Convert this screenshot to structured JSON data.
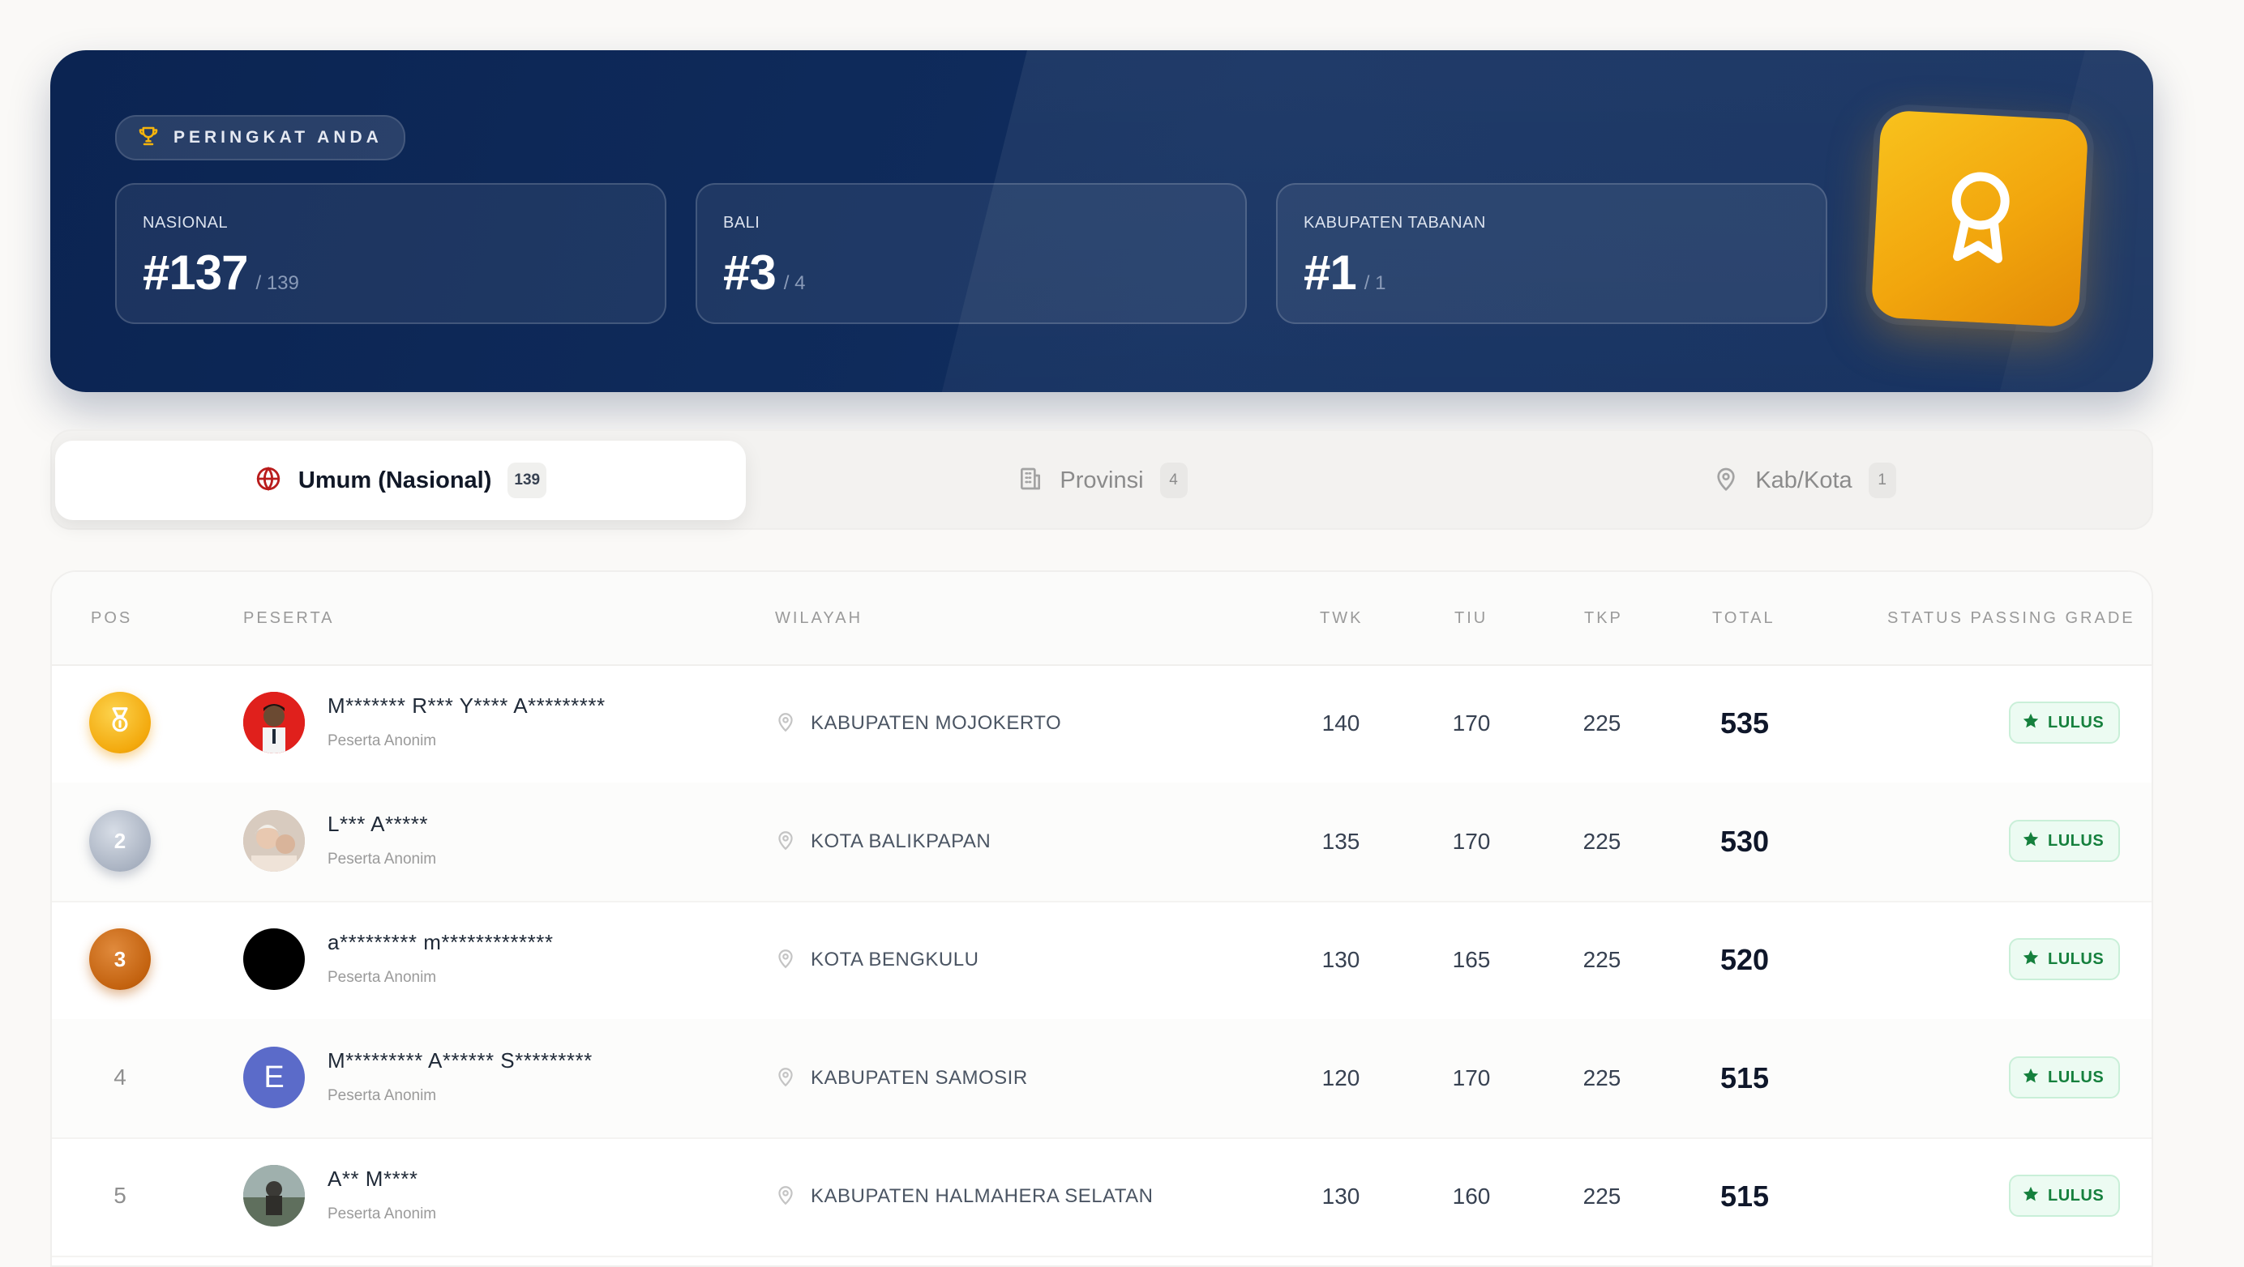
{
  "hero": {
    "label": "PERINGKAT ANDA",
    "cards": [
      {
        "label": "NASIONAL",
        "rank": "#137",
        "of": "/ 139"
      },
      {
        "label": "BALI",
        "rank": "#3",
        "of": "/ 4"
      },
      {
        "label": "KABUPATEN TABANAN",
        "rank": "#1",
        "of": "/ 1"
      }
    ]
  },
  "tabs": [
    {
      "label": "Umum (Nasional)",
      "count": "139",
      "icon": "globe-icon",
      "active": true
    },
    {
      "label": "Provinsi",
      "count": "4",
      "icon": "building-icon",
      "active": false
    },
    {
      "label": "Kab/Kota",
      "count": "1",
      "icon": "map-pin-icon",
      "active": false
    }
  ],
  "table": {
    "headers": {
      "pos": "POS",
      "peserta": "PESERTA",
      "wilayah": "WILAYAH",
      "twk": "TWK",
      "tiu": "TIU",
      "tkp": "TKP",
      "total": "TOTAL",
      "status": "STATUS PASSING GRADE"
    },
    "rows": [
      {
        "pos": "",
        "name": "M******* R*** Y**** A*********",
        "sub": "Peserta Anonim",
        "region": "KABUPATEN MOJOKERTO",
        "twk": "140",
        "tiu": "170",
        "tkp": "225",
        "total": "535",
        "status": "LULUS"
      },
      {
        "pos": "2",
        "name": "L*** A*****",
        "sub": "Peserta Anonim",
        "region": "KOTA BALIKPAPAN",
        "twk": "135",
        "tiu": "170",
        "tkp": "225",
        "total": "530",
        "status": "LULUS"
      },
      {
        "pos": "3",
        "name": "a********* m*************",
        "sub": "Peserta Anonim",
        "region": "KOTA BENGKULU",
        "twk": "130",
        "tiu": "165",
        "tkp": "225",
        "total": "520",
        "status": "LULUS"
      },
      {
        "pos": "4",
        "name": "M********* A****** S*********",
        "sub": "Peserta Anonim",
        "region": "KABUPATEN SAMOSIR",
        "twk": "120",
        "tiu": "170",
        "tkp": "225",
        "total": "515",
        "status": "LULUS"
      },
      {
        "pos": "5",
        "name": "A** M****",
        "sub": "Peserta Anonim",
        "region": "KABUPATEN HALMAHERA SELATAN",
        "twk": "130",
        "tiu": "160",
        "tkp": "225",
        "total": "515",
        "status": "LULUS"
      }
    ],
    "avatar_letter_row4": "E"
  },
  "colors": {
    "hero_bg": "#0b2452",
    "gold": "#f3a90d",
    "silver": "#aab3c2",
    "bronze": "#c3620f",
    "status_green": "#15803d",
    "avatar_purple": "#5b6bc9"
  }
}
